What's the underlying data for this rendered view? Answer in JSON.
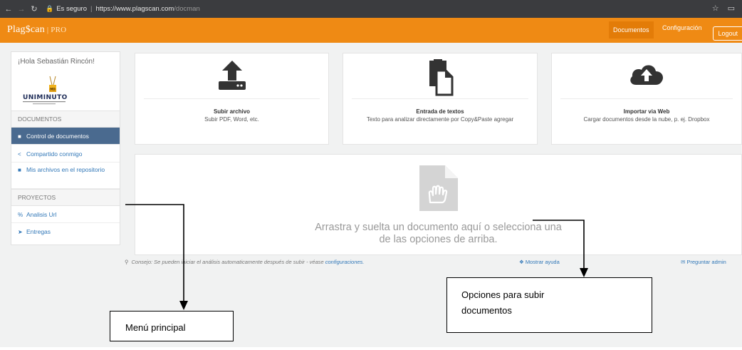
{
  "browser": {
    "secure_label": "Es seguro",
    "url_domain": "https://www.plagscan.com",
    "url_path": "/docman"
  },
  "header": {
    "logo_text": "Plag$can",
    "logo_pro": "PRO",
    "nav_documents": "Documentos",
    "nav_config": "Configuración",
    "logout": "Logout"
  },
  "sidebar": {
    "greeting": "¡Hola Sebastián Rincón!",
    "logo_text": "UNIMINUTO",
    "section_documents": "DOCUMENTOS",
    "items": [
      {
        "icon": "file-icon",
        "label": "Control de documentos",
        "active": true
      },
      {
        "icon": "share-icon",
        "label": "Compartido conmigo",
        "active": false
      },
      {
        "icon": "archive-icon",
        "label": "Mis archivos en el repositorio",
        "active": false
      }
    ],
    "section_projects": "PROYECTOS",
    "project_items": [
      {
        "icon": "link-icon",
        "label": "Analisis Url"
      },
      {
        "icon": "send-icon",
        "label": "Entregas"
      }
    ]
  },
  "cards": [
    {
      "icon": "upload-icon",
      "title": "Subir archivo",
      "desc": "Subir PDF, Word, etc."
    },
    {
      "icon": "paste-icon",
      "title": "Entrada de textos",
      "desc": "Texto para analizar directamente por Copy&Paste agregar"
    },
    {
      "icon": "cloud-upload-icon",
      "title": "Importar via Web",
      "desc": "Cargar documentos desde la nube, p. ej. Dropbox"
    }
  ],
  "dropzone": {
    "line1": "Arrastra y suelta un documento aquí o selecciona una",
    "line2": "de las opciones de arriba."
  },
  "footer": {
    "tip_prefix": "Consejo: Se pueden iniciar el análisis automaticamente después de subir - véase",
    "tip_link": "configuraciones.",
    "help": "Mostrar ayuda",
    "ask": "Preguntar admin"
  },
  "annotations": {
    "menu": "Menú principal",
    "upload_line1": "Opciones para subir",
    "upload_line2": "documentos"
  }
}
